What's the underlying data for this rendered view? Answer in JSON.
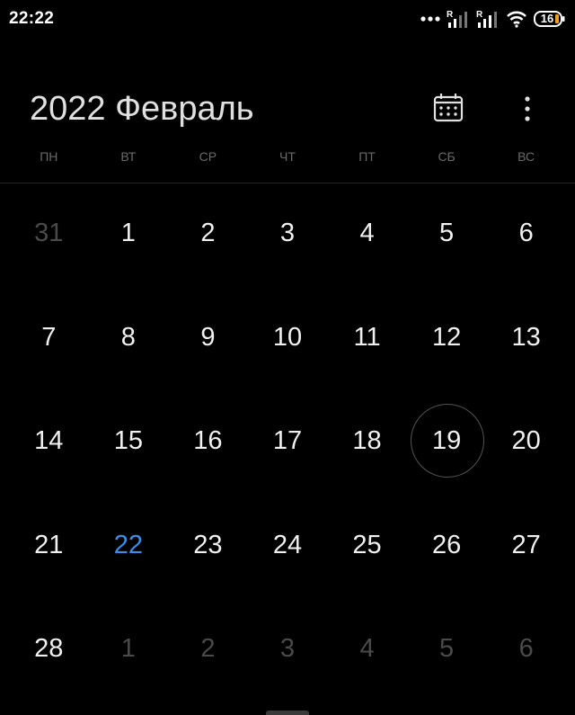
{
  "status_bar": {
    "time": "22:22",
    "battery": "16",
    "signal_badge_1": "R",
    "signal_badge_2": "R"
  },
  "header": {
    "year": "2022",
    "month": "Февраль",
    "calendar_icon": "calendar-icon",
    "more_icon": "more-vertical-icon"
  },
  "weekdays": [
    "ПН",
    "ВТ",
    "СР",
    "ЧТ",
    "ПТ",
    "СБ",
    "ВС"
  ],
  "weeks": [
    [
      {
        "day": "31",
        "outside": true
      },
      {
        "day": "1"
      },
      {
        "day": "2"
      },
      {
        "day": "3"
      },
      {
        "day": "4"
      },
      {
        "day": "5"
      },
      {
        "day": "6"
      }
    ],
    [
      {
        "day": "7"
      },
      {
        "day": "8"
      },
      {
        "day": "9"
      },
      {
        "day": "10"
      },
      {
        "day": "11"
      },
      {
        "day": "12"
      },
      {
        "day": "13"
      }
    ],
    [
      {
        "day": "14"
      },
      {
        "day": "15"
      },
      {
        "day": "16"
      },
      {
        "day": "17"
      },
      {
        "day": "18"
      },
      {
        "day": "19",
        "selected": true
      },
      {
        "day": "20"
      }
    ],
    [
      {
        "day": "21"
      },
      {
        "day": "22",
        "today": true
      },
      {
        "day": "23"
      },
      {
        "day": "24"
      },
      {
        "day": "25"
      },
      {
        "day": "26"
      },
      {
        "day": "27"
      }
    ],
    [
      {
        "day": "28"
      },
      {
        "day": "1",
        "outside": true
      },
      {
        "day": "2",
        "outside": true
      },
      {
        "day": "3",
        "outside": true
      },
      {
        "day": "4",
        "outside": true
      },
      {
        "day": "5",
        "outside": true
      },
      {
        "day": "6",
        "outside": true
      }
    ]
  ],
  "colors": {
    "background": "#000000",
    "today": "#3a8ee6",
    "outside_day": "#4a4a4a",
    "weekday_label": "#6a6a6a"
  }
}
